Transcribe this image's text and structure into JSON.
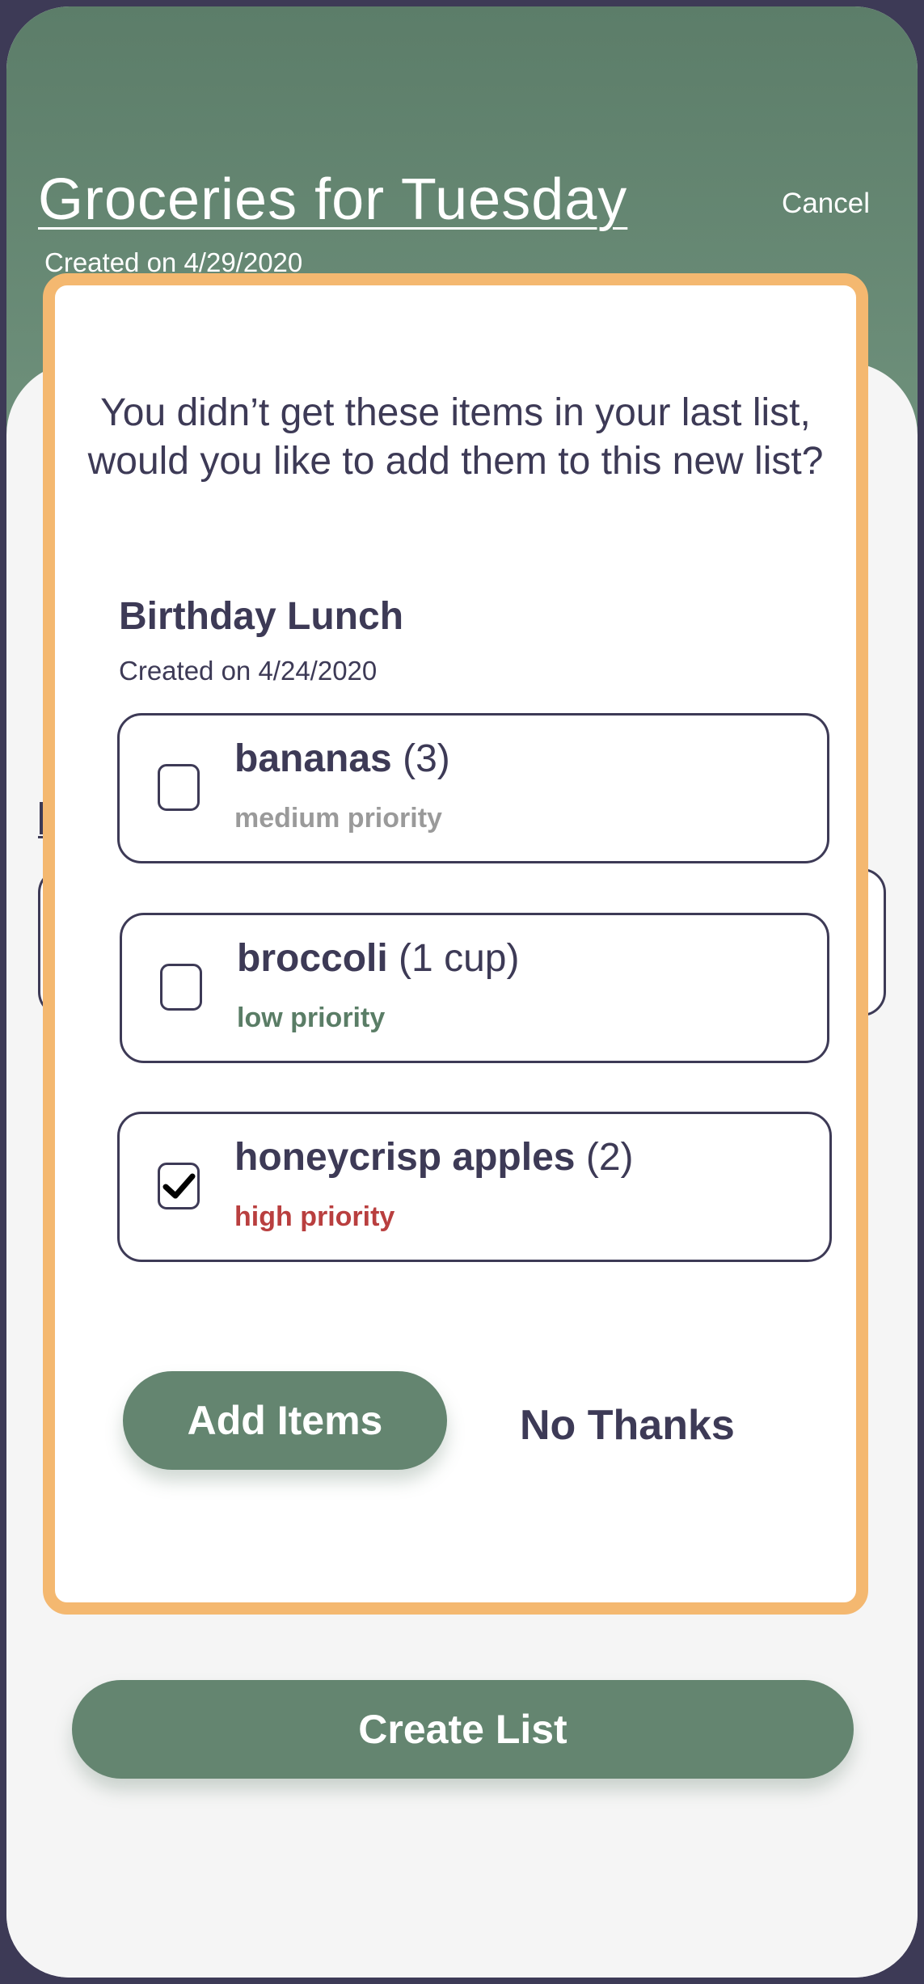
{
  "header": {
    "title": "Groceries for Tuesday",
    "created": "Created on 4/29/2020",
    "cancel_label": "Cancel"
  },
  "modal": {
    "question": "You didn’t get these items in your last list, would you like to add them to this new list?",
    "previous_list": {
      "title": "Birthday Lunch",
      "created": "Created on 4/24/2020"
    },
    "items": [
      {
        "name": "bananas",
        "quantity": "(3)",
        "priority": "medium priority",
        "priority_color": "#9a9a9a",
        "checked": false
      },
      {
        "name": "broccoli",
        "quantity": "(1 cup)",
        "priority": "low priority",
        "priority_color": "#5a7d66",
        "checked": false
      },
      {
        "name": "honeycrisp apples",
        "quantity": "(2)",
        "priority": "high priority",
        "priority_color": "#b93f3f",
        "checked": true
      }
    ],
    "add_label": "Add Items",
    "decline_label": "No Thanks"
  },
  "footer": {
    "create_label": "Create List"
  },
  "colors": {
    "accent": "#648570",
    "modal_border": "#f4b870",
    "text": "#3d3a56"
  }
}
